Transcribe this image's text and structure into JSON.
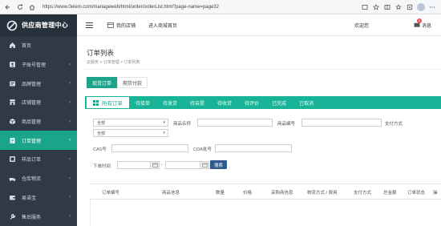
{
  "browser": {
    "url": "https://www.0elem.com/manageweb/html/order/orderList.html?page-name=page32"
  },
  "sidebar": {
    "logo": "供应商管理中心",
    "items": [
      {
        "label": "首页",
        "icon": "home-icon",
        "chevron": false
      },
      {
        "label": "子账号管理",
        "icon": "user-icon",
        "chevron": true
      },
      {
        "label": "品牌管理",
        "icon": "brand-icon",
        "chevron": true
      },
      {
        "label": "店铺管理",
        "icon": "store-icon",
        "chevron": true
      },
      {
        "label": "商品管理",
        "icon": "box-icon",
        "chevron": true
      },
      {
        "label": "订单管理",
        "icon": "order-icon",
        "chevron": true,
        "active": true
      },
      {
        "label": "样品订单",
        "icon": "sample-icon",
        "chevron": true
      },
      {
        "label": "仓库物流",
        "icon": "warehouse-icon",
        "chevron": true
      },
      {
        "label": "易诺宝",
        "icon": "wallet-icon",
        "chevron": true
      },
      {
        "label": "售后服务",
        "icon": "service-icon",
        "chevron": true
      }
    ]
  },
  "header": {
    "my_store": "我的店铺",
    "enter_mall": "进入商城首页",
    "welcome": "欢迎您",
    "messages": "消息",
    "message_count": "0"
  },
  "page": {
    "title": "订单列表",
    "breadcrumb": "云服务 > 订单管理 > 订单列表",
    "top_tabs": [
      "现货订单",
      "期货付款"
    ],
    "status_tabs": [
      "所有订单",
      "待接单",
      "待发货",
      "待自提",
      "待收货",
      "待评价",
      "已完成",
      "已取消"
    ]
  },
  "filters": {
    "select1": "全部",
    "select2": "全部",
    "product_name": "商品名称",
    "product_no": "商品编号",
    "payment": "支付方式",
    "cas": "CAS号",
    "coa": "COA批号",
    "order_time": "下单时间",
    "date_sep": "-",
    "search": "搜索"
  },
  "table": {
    "headers": [
      "订单编号",
      "商品信息",
      "数量",
      "价格",
      "采购商信息",
      "物流方式 / 费用",
      "支付方式",
      "总金额",
      "订单状态",
      "操"
    ]
  },
  "colors": {
    "sidebar_bg": "#2f3a45",
    "accent": "#1aa58a",
    "status_bar": "#19b497",
    "search_button": "#2e5b8c"
  }
}
